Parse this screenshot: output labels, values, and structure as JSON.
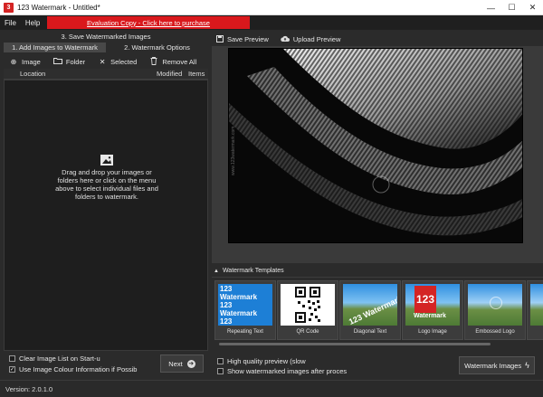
{
  "window": {
    "title": "123 Watermark - Untitled*",
    "app_icon_text": "3",
    "controls": [
      "—",
      "☐",
      "✕"
    ]
  },
  "menu": {
    "items": [
      "File",
      "Help"
    ],
    "banner": "Evaluation Copy - Click here to purchase"
  },
  "tabs": {
    "save": "3. Save Watermarked Images",
    "add": "1. Add Images to Watermark",
    "options": "2. Watermark Options"
  },
  "toolbar": {
    "image": "Image",
    "folder": "Folder",
    "selected": "Selected",
    "remove_all": "Remove All"
  },
  "list": {
    "col_location": "Location",
    "col_modified": "Modified",
    "col_items": "Items",
    "drop_hint": "Drag and drop your images or folders here or click on the menu above to select individual files and folders to watermark."
  },
  "left_options": {
    "clear_list": "Clear Image List on Start-u",
    "clear_checked": false,
    "use_colour": "Use Image Colour Information if Possib",
    "use_colour_checked": true
  },
  "next_button": "Next",
  "preview_toolbar": {
    "save_preview": "Save Preview",
    "upload_preview": "Upload Preview"
  },
  "preview": {
    "watermark_text": "www.123watermark.com"
  },
  "templates": {
    "header": "Watermark Templates",
    "items": [
      {
        "caption": "Repeating Text",
        "type": "repeating",
        "text": "123 Watermark"
      },
      {
        "caption": "QR Code",
        "type": "qr"
      },
      {
        "caption": "Diagonal Text",
        "type": "diagonal",
        "text": "123 Watermark"
      },
      {
        "caption": "Logo Image",
        "type": "logo",
        "logo": "123",
        "text": "Watermark"
      },
      {
        "caption": "Embossed Logo",
        "type": "embossed"
      }
    ]
  },
  "right_options": {
    "high_quality": "High quality preview (slow",
    "high_quality_checked": false,
    "show_after": "Show watermarked images after proces",
    "show_after_checked": false
  },
  "watermark_images_button": "Watermark Images",
  "status": {
    "version": "Version: 2.0.1.0"
  },
  "colors": {
    "banner": "#d9181c",
    "accent_blue": "#1d7fd6",
    "logo_red": "#d42424"
  }
}
